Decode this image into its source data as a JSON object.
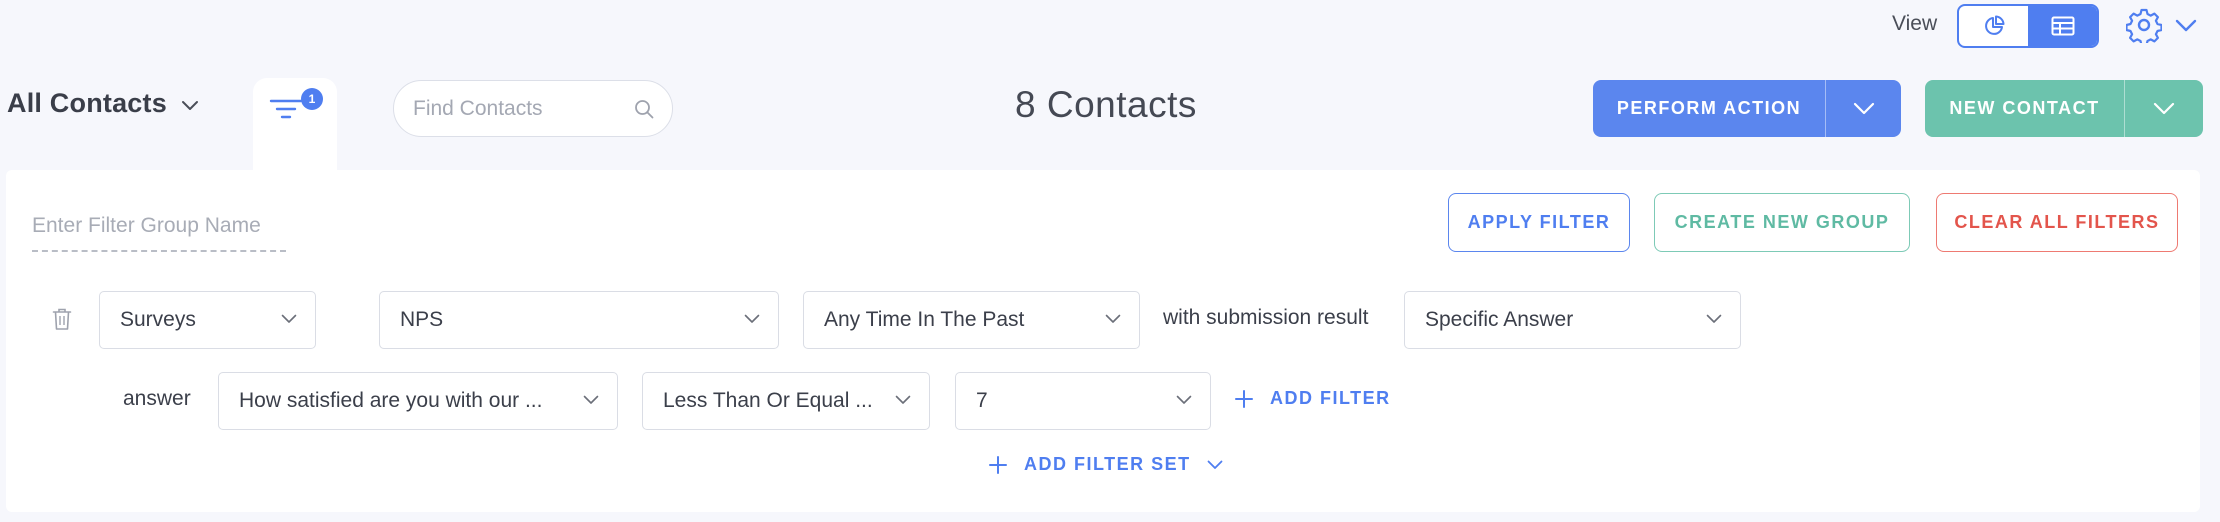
{
  "view": {
    "label": "View",
    "options": [
      {
        "icon": "pie-chart-icon",
        "active": false
      },
      {
        "icon": "table-grid-icon",
        "active": true
      }
    ]
  },
  "toolbar": {
    "list_name": "All Contacts",
    "filter_badge_count": "1",
    "search_placeholder": "Find Contacts",
    "contacts_count": "8 Contacts",
    "perform_action_label": "PERFORM ACTION",
    "new_contact_label": "NEW CONTACT"
  },
  "filter_panel": {
    "group_name_placeholder": "Enter Filter Group Name",
    "apply_label": "APPLY FILTER",
    "create_group_label": "CREATE NEW GROUP",
    "clear_all_label": "CLEAR ALL FILTERS",
    "row1": {
      "source": "Surveys",
      "survey": "NPS",
      "time_range": "Any Time In The Past",
      "connector_text": "with submission result",
      "result": "Specific Answer"
    },
    "row2": {
      "label": "answer",
      "question": "How satisfied are you with our ...",
      "operator": "Less Than Or Equal ...",
      "value": "7"
    },
    "add_filter_label": "ADD FILTER",
    "add_filter_set_label": "ADD FILTER SET"
  },
  "colors": {
    "primary_blue": "#5b86ee",
    "teal": "#6cc3ad",
    "danger_red": "#e3554c",
    "background": "#f6f7fc"
  }
}
